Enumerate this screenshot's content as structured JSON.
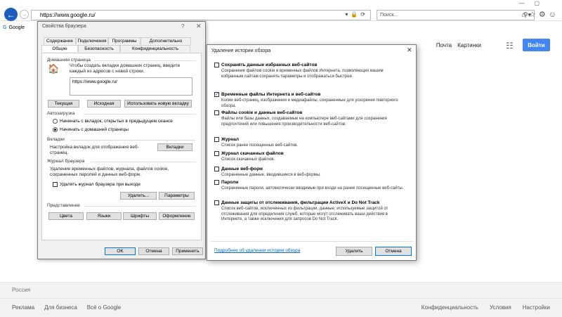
{
  "browser": {
    "address": "https://www.google.ru/",
    "search_placeholder": "Поиск...",
    "tab_title": "Google",
    "tab_logo": "G",
    "back_icon": "back-arrow-icon",
    "forward_icon": "forward-arrow-icon"
  },
  "google": {
    "links": [
      "Почта",
      "Картинки"
    ],
    "sign_in": "Войти",
    "country": "Россия",
    "footer_left": [
      "Реклама",
      "Для бизнеса",
      "Всё о Google"
    ],
    "footer_right": [
      "Конфиденциальность",
      "Условия",
      "Настройки"
    ],
    "accent": "#4285f4"
  },
  "options": {
    "title": "Свойства браузера",
    "help": "?",
    "close": "✕",
    "tabs_top": [
      "Содержание",
      "Подключения",
      "Программы",
      "Дополнительно"
    ],
    "tabs_bottom": [
      "Общие",
      "Безопасность",
      "Конфиденциальность"
    ],
    "home": {
      "section": "Домашняя страница",
      "desc": "Чтобы создать вкладки домашних страниц, введите каждый из адресов с новой строки.",
      "url": "https://www.google.ru/",
      "btn_current": "Текущая",
      "btn_default": "Исходная",
      "btn_newtab": "Использовать новую вкладку"
    },
    "startup": {
      "section": "Автозагрузка",
      "opt1": "Начинать с вкладок, открытых в предыдущем сеансе",
      "opt2": "Начинать с домашней страницы"
    },
    "tabs_section": {
      "section": "Вкладки",
      "desc": "Настройка вкладок для отображения веб-страниц.",
      "btn": "Вкладки"
    },
    "history": {
      "section": "Журнал браузера",
      "desc": "Удаление временных файлов, журнала, файлов cookie, сохраненных паролей и данных веб-форм.",
      "checkbox": "Удалять журнал браузера при выходе",
      "btn_delete": "Удалить...",
      "btn_params": "Параметры"
    },
    "appearance": {
      "section": "Представление",
      "btns": [
        "Цвета",
        "Языки",
        "Шрифты",
        "Оформление"
      ]
    },
    "footer": {
      "ok": "OK",
      "cancel": "Отмена",
      "apply": "Применить"
    }
  },
  "delete_dialog": {
    "title": "Удаление истории обзора",
    "close": "✕",
    "items": [
      {
        "title": "Сохранять данные избранных веб-сайтов",
        "desc": "Сохранение файлов cookie и временных файлов Интернета, позволяющих вашим избранным сайтам сохранять параметры и отображаться быстрее.",
        "checked": false
      },
      {
        "title": "Временные файлы Интернета и веб-сайтов",
        "desc": "Копии веб-страниц, изображения и медиафайлы, сохраненные для ускорения повторного обзора.",
        "checked": true
      },
      {
        "title": "Файлы cookie и данные веб-сайтов",
        "desc": "Файлы или базы данных, создаваемые на компьютере веб-сайтами для сохранения предпочтений или повышения производительности веб-сайтов.",
        "checked": false
      },
      {
        "title": "Журнал",
        "desc": "Список ранее посещенных веб-сайтов.",
        "checked": false
      },
      {
        "title": "Журнал скачанных файлов",
        "desc": "Список скачанных файлов.",
        "checked": false
      },
      {
        "title": "Данные веб-форм",
        "desc": "Сохраненные данные, вводившиеся в веб-формы.",
        "checked": false
      },
      {
        "title": "Пароли",
        "desc": "Сохраненные пароли, автоматически вводимые при входе на ранее посещенные веб-сайты.",
        "checked": false
      },
      {
        "title": "Данные защиты от отслеживания, фильтрации ActiveX и Do Not Track",
        "desc": "Список веб-сайтов, исключенных из фильтрации, данные, используемые защитой от отслеживания для определения служб, которые могут отслеживать ваши действия в Интернете, а также исключения для запросов Do Not Track.",
        "checked": false
      }
    ],
    "link": "Подробнее об удалении истории обзора",
    "btn_delete": "Удалить",
    "btn_cancel": "Отмена"
  }
}
